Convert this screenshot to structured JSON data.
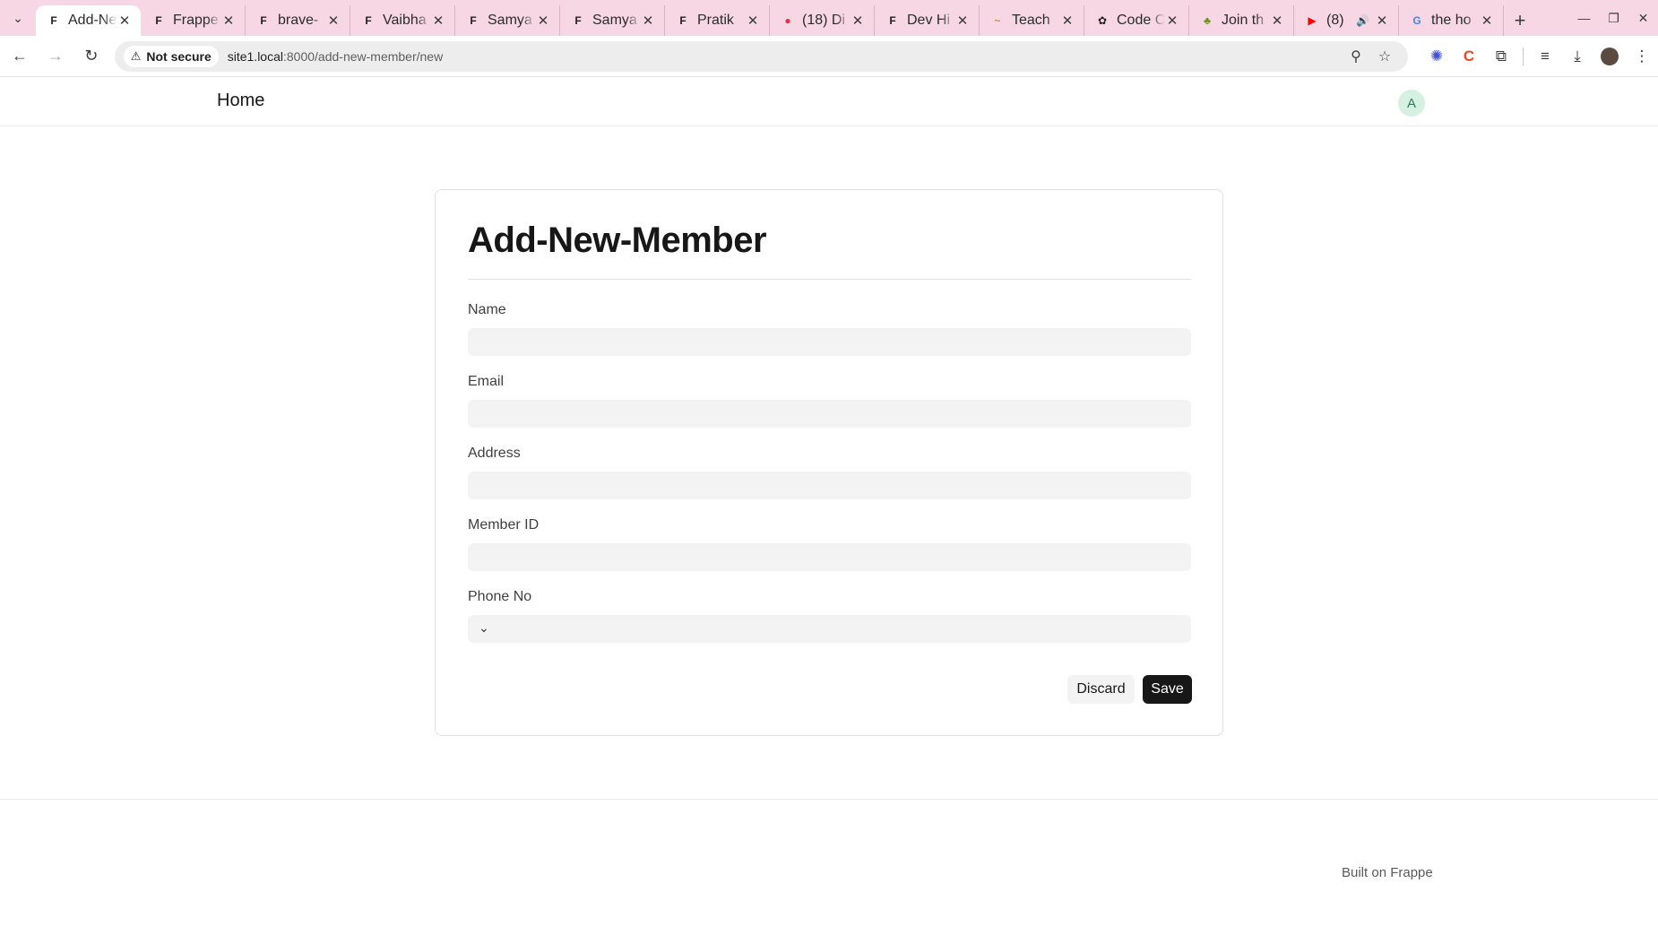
{
  "browser": {
    "tabs": [
      {
        "title": "Add-New-Member",
        "favicon": "frappe-icon",
        "active": true
      },
      {
        "title": "Frappe",
        "favicon": "frappe-icon"
      },
      {
        "title": "brave-",
        "favicon": "frappe-icon"
      },
      {
        "title": "Vaibha",
        "favicon": "frappe-icon"
      },
      {
        "title": "Samya",
        "favicon": "frappe-icon"
      },
      {
        "title": "Samya",
        "favicon": "frappe-icon"
      },
      {
        "title": "Pratik",
        "favicon": "frappe-icon"
      },
      {
        "title": "(18) Di",
        "favicon": "app-icon"
      },
      {
        "title": "Dev Hi",
        "favicon": "frappe-icon"
      },
      {
        "title": "Teach",
        "favicon": "brush-icon"
      },
      {
        "title": "Code C",
        "favicon": "openai-icon"
      },
      {
        "title": "Join th",
        "favicon": "game-icon"
      },
      {
        "title": "(8)",
        "favicon": "youtube-icon",
        "audio": true
      },
      {
        "title": "the ho",
        "favicon": "google-icon"
      }
    ],
    "security_label": "Not secure",
    "url_host": "site1.local",
    "url_path": ":8000/add-new-member/new"
  },
  "navbar": {
    "home_label": "Home",
    "avatar_initial": "A"
  },
  "form": {
    "title": "Add-New-Member",
    "fields": [
      {
        "label": "Name",
        "value": ""
      },
      {
        "label": "Email",
        "value": ""
      },
      {
        "label": "Address",
        "value": ""
      },
      {
        "label": "Member ID",
        "value": ""
      },
      {
        "label": "Phone No",
        "value": ""
      }
    ],
    "discard_label": "Discard",
    "save_label": "Save"
  },
  "footer": {
    "built_on": "Built on Frappe"
  },
  "colors": {
    "tabstrip": "#f7d7e4",
    "primary_button": "#171717",
    "avatar_bg": "#d6f0e2"
  }
}
